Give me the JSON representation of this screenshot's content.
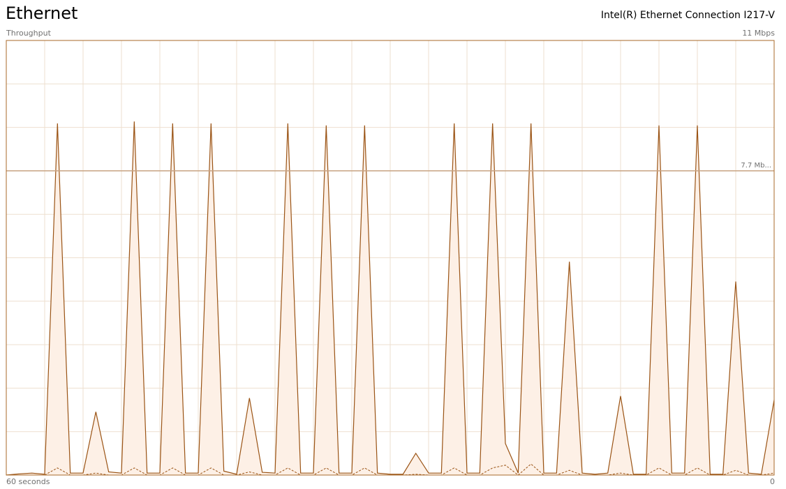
{
  "header": {
    "title": "Ethernet",
    "adapter_name": "Intel(R) Ethernet Connection I217-V"
  },
  "chart_labels": {
    "y_caption": "Throughput",
    "y_max_label": "11 Mbps",
    "x_start_label": "60 seconds",
    "x_end_label": "0",
    "reference_line_label": "7.7 Mb..."
  },
  "colors": {
    "line": "#9a5314",
    "fill": "#fdf0e6",
    "grid": "#eedfcf",
    "border": "#a86a2a",
    "reference_line": "#c8a382"
  },
  "chart_data": {
    "type": "area",
    "xlabel": "60 seconds",
    "ylabel": "Throughput",
    "unit": "Mbps",
    "xlim": [
      60,
      0
    ],
    "ylim": [
      0,
      11
    ],
    "grid": true,
    "reference_line": {
      "value": 7.7,
      "label": "7.7 Mb..."
    },
    "series": [
      {
        "role": "primary",
        "style": "solid",
        "values": [
          0,
          0.03,
          0.05,
          0.02,
          8.9,
          0.05,
          0.05,
          1.6,
          0.08,
          0.05,
          8.95,
          0.05,
          0.05,
          8.9,
          0.05,
          0.05,
          8.9,
          0.1,
          0.02,
          1.95,
          0.07,
          0.05,
          8.9,
          0.05,
          0.05,
          8.85,
          0.05,
          0.05,
          8.85,
          0.05,
          0.02,
          0.02,
          0.55,
          0.05,
          0.05,
          8.9,
          0.05,
          0.05,
          8.9,
          0.8,
          0.05,
          8.9,
          0.05,
          0.05,
          5.4,
          0.05,
          0.02,
          0.05,
          2.0,
          0.02,
          0.02,
          8.85,
          0.05,
          0.05,
          8.85,
          0.02,
          0.02,
          4.9,
          0.05,
          0.02,
          1.9
        ]
      },
      {
        "role": "secondary",
        "style": "dashed",
        "values": [
          0,
          0,
          0,
          0,
          0.18,
          0,
          0,
          0.05,
          0,
          0,
          0.18,
          0,
          0,
          0.18,
          0,
          0,
          0.18,
          0,
          0,
          0.08,
          0,
          0,
          0.18,
          0,
          0,
          0.18,
          0,
          0,
          0.18,
          0,
          0,
          0,
          0.02,
          0,
          0,
          0.18,
          0,
          0,
          0.18,
          0.25,
          0,
          0.28,
          0,
          0,
          0.12,
          0,
          0,
          0,
          0.05,
          0,
          0,
          0.18,
          0,
          0,
          0.18,
          0,
          0,
          0.12,
          0,
          0,
          0.05
        ]
      }
    ]
  }
}
